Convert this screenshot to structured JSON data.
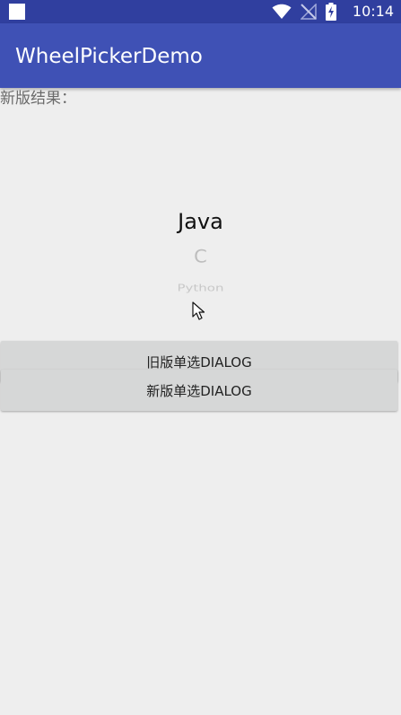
{
  "status_bar": {
    "time": "10:14",
    "icons": [
      "notification-square-icon",
      "wifi-icon",
      "no-signal-icon",
      "battery-charging-icon"
    ]
  },
  "app_bar": {
    "title": "WheelPickerDemo",
    "color": "#3f51b5",
    "status_color": "#303f9f"
  },
  "result": {
    "label": "新版结果："
  },
  "wheel_picker": {
    "items": [
      "Java",
      "C",
      "Python",
      "..."
    ],
    "selected": "Java"
  },
  "buttons": {
    "old_dialog": "旧版单选DIALOG",
    "new_dialog": "新版单选DIALOG"
  }
}
